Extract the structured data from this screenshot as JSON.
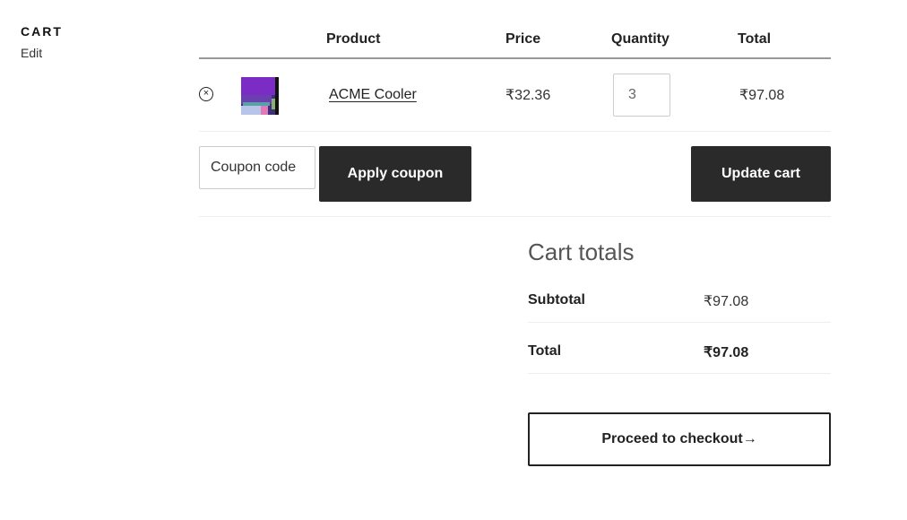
{
  "sidebar": {
    "title": "CART",
    "edit_label": "Edit"
  },
  "table": {
    "headers": {
      "product": "Product",
      "price": "Price",
      "quantity": "Quantity",
      "total": "Total"
    },
    "items": [
      {
        "remove_symbol": "×",
        "name": "ACME Cooler",
        "price": "₹32.36",
        "quantity": "3",
        "total": "₹97.08"
      }
    ]
  },
  "actions": {
    "coupon_placeholder": "Coupon code",
    "apply_coupon_label": "Apply coupon",
    "update_cart_label": "Update cart"
  },
  "totals": {
    "title": "Cart totals",
    "subtotal_label": "Subtotal",
    "subtotal_value": "₹97.08",
    "total_label": "Total",
    "total_value": "₹97.08"
  },
  "checkout": {
    "label": "Proceed to checkout→"
  },
  "colors": {
    "button_dark": "#2a2a2a",
    "text": "#333333",
    "border_light": "#eeeeee"
  }
}
